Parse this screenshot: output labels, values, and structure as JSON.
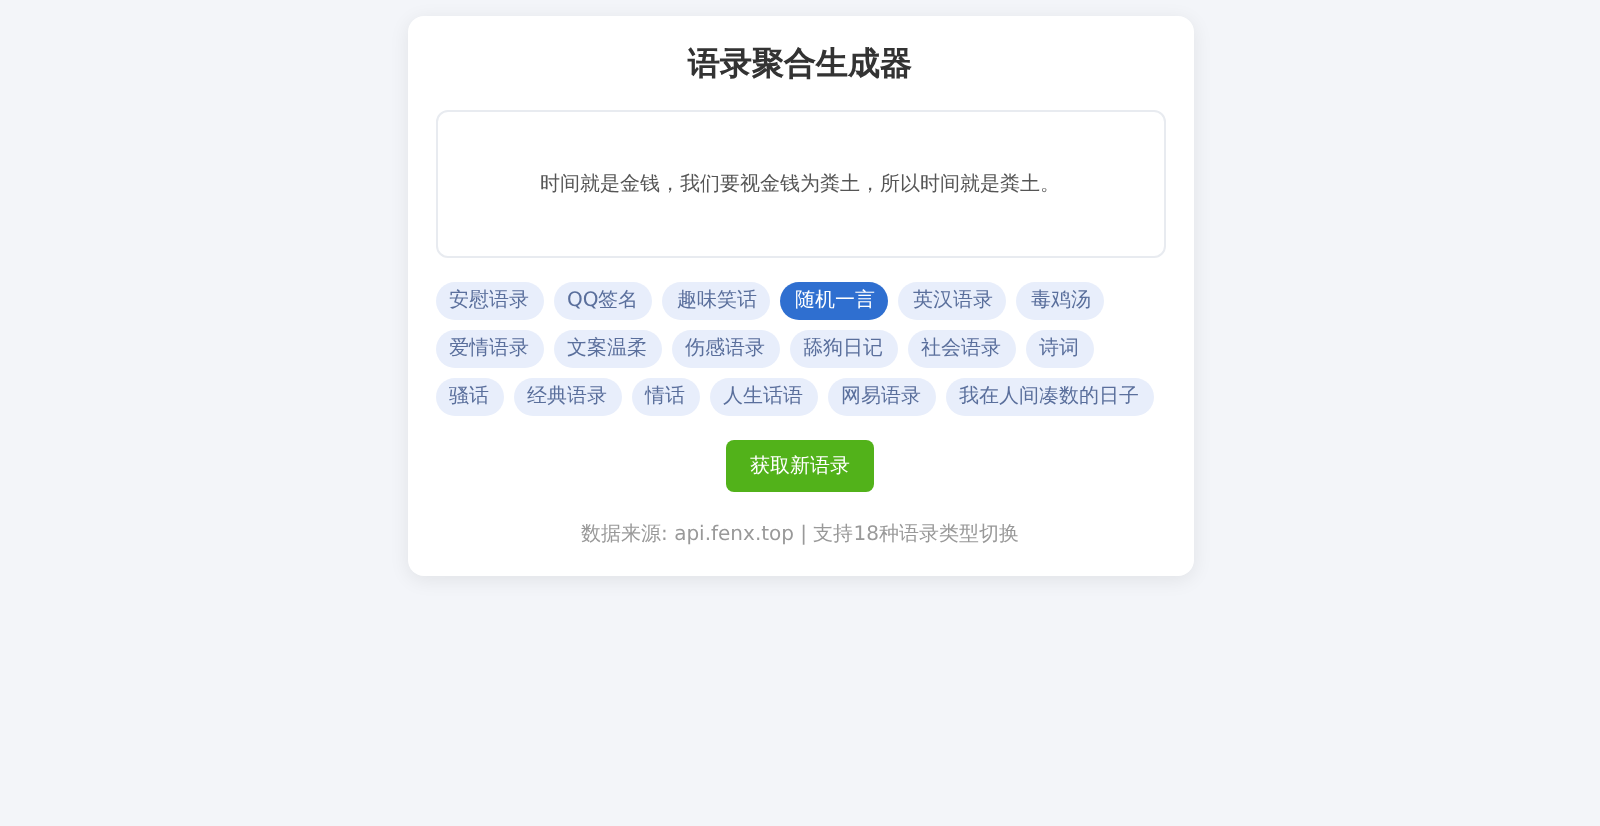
{
  "title": "语录聚合生成器",
  "quote": "时间就是金钱，我们要视金钱为粪土，所以时间就是粪土。",
  "categories": [
    {
      "label": "安慰语录",
      "selected": false
    },
    {
      "label": "QQ签名",
      "selected": false
    },
    {
      "label": "趣味笑话",
      "selected": false
    },
    {
      "label": "随机一言",
      "selected": true
    },
    {
      "label": "英汉语录",
      "selected": false
    },
    {
      "label": "毒鸡汤",
      "selected": false
    },
    {
      "label": "爱情语录",
      "selected": false
    },
    {
      "label": "文案温柔",
      "selected": false
    },
    {
      "label": "伤感语录",
      "selected": false
    },
    {
      "label": "舔狗日记",
      "selected": false
    },
    {
      "label": "社会语录",
      "selected": false
    },
    {
      "label": "诗词",
      "selected": false
    },
    {
      "label": "骚话",
      "selected": false
    },
    {
      "label": "经典语录",
      "selected": false
    },
    {
      "label": "情话",
      "selected": false
    },
    {
      "label": "人生话语",
      "selected": false
    },
    {
      "label": "网易语录",
      "selected": false
    },
    {
      "label": "我在人间凑数的日子",
      "selected": false
    }
  ],
  "button": "获取新语录",
  "footer": "数据来源: api.fenx.top | 支持18种语录类型切换"
}
